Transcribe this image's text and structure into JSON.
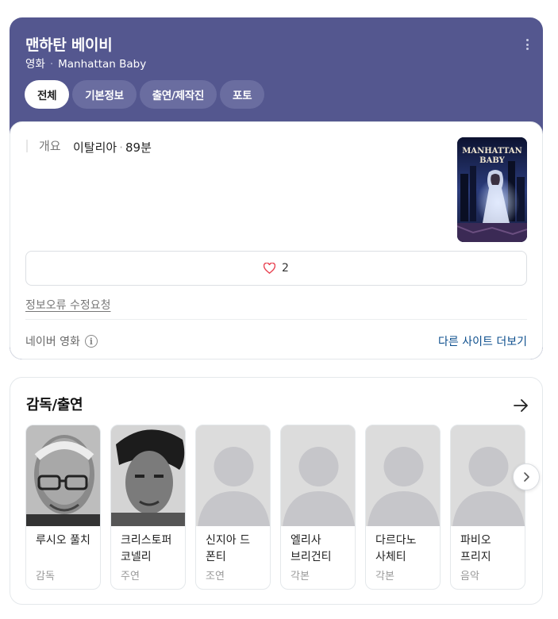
{
  "movie": {
    "title": "맨하탄 베이비",
    "category": "영화",
    "original_title": "Manhattan Baby",
    "sep": "·"
  },
  "tabs": [
    {
      "label": "전체",
      "active": true
    },
    {
      "label": "기본정보",
      "active": false
    },
    {
      "label": "출연/제작진",
      "active": false
    },
    {
      "label": "포토",
      "active": false
    }
  ],
  "overview": {
    "label": "개요",
    "country": "이탈리아",
    "runtime": "89분",
    "poster_text": [
      "MANHATTAN",
      "BABY"
    ]
  },
  "like": {
    "count": "2",
    "icon": "heart-icon"
  },
  "report_link": "정보오류 수정요청",
  "source": {
    "label": "네이버 영화",
    "other_sites": "다른 사이트 더보기"
  },
  "cast_section": {
    "title": "감독/출연",
    "people": [
      {
        "name": "루시오 풀치",
        "role": "감독",
        "photo": "photo-bw"
      },
      {
        "name": "크리스토퍼 코넬리",
        "role": "주연",
        "photo": "photo-bw"
      },
      {
        "name": "신지아 드 폰티",
        "role": "조연",
        "photo": "placeholder"
      },
      {
        "name": "엘리사 브리건티",
        "role": "각본",
        "photo": "placeholder"
      },
      {
        "name": "다르다노 사체티",
        "role": "각본",
        "photo": "placeholder"
      },
      {
        "name": "파비오 프리지",
        "role": "음악",
        "photo": "placeholder"
      }
    ]
  },
  "colors": {
    "header_bg": "#54578f",
    "tab_bg": "#6a6da0",
    "link": "#0b4d8c",
    "heart": "#e8404f"
  }
}
